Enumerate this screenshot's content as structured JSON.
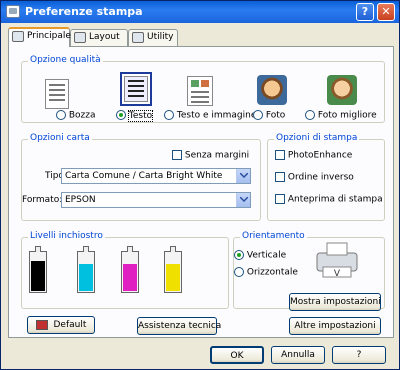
{
  "window": {
    "title": "Preferenze stampa",
    "help": "?",
    "close": "✕"
  },
  "tabs": [
    {
      "label": "Principale",
      "icon": "printer-icon",
      "active": true
    },
    {
      "label": "Layout",
      "icon": "layout-icon"
    },
    {
      "label": "Utility",
      "icon": "utility-icon"
    }
  ],
  "quality": {
    "legend": "Opzione qualità",
    "options": [
      {
        "label": "Bozza",
        "selected": false
      },
      {
        "label": "Testo",
        "selected": true
      },
      {
        "label": "Testo e immagine",
        "selected": false
      },
      {
        "label": "Foto",
        "selected": false
      },
      {
        "label": "Foto migliore",
        "selected": false
      }
    ]
  },
  "paper": {
    "legend": "Opzioni carta",
    "borderless_label": "Senza margini",
    "type_label": "Tipo:",
    "type_value": "Carta Comune / Carta Bright White",
    "format_label": "Formato:",
    "format_value": "EPSON"
  },
  "print_options": {
    "legend": "Opzioni di stampa",
    "items": [
      "PhotoEnhance",
      "Ordine inverso",
      "Anteprima di stampa"
    ]
  },
  "ink": {
    "legend": "Livelli inchiostro",
    "colors": [
      "#000000",
      "#00c0e0",
      "#e020c0",
      "#f0e000"
    ],
    "levels": [
      0.8,
      0.7,
      0.7,
      0.7
    ]
  },
  "orientation": {
    "legend": "Orientamento",
    "portrait": "Verticale",
    "landscape": "Orizzontale",
    "selected": "portrait"
  },
  "buttons": {
    "show_settings": "Mostra impostazioni",
    "default": "Default",
    "tech_support": "Assistenza tecnica",
    "other_settings": "Altre impostazioni",
    "ok": "OK",
    "cancel": "Annulla",
    "help": "?"
  },
  "colors": {
    "accent": "#0046d5",
    "title_bar": "#0a5fd6",
    "tab_highlight": "#e69a2b"
  }
}
